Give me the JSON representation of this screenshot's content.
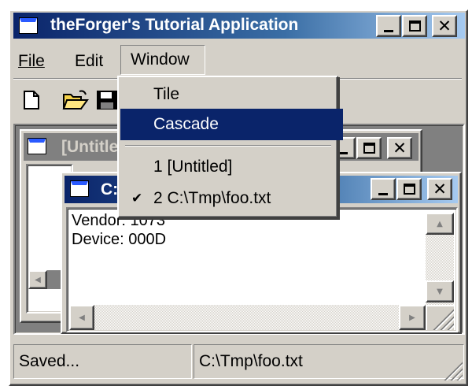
{
  "app": {
    "title": "theForger's Tutorial Application",
    "colors": {
      "face": "#d4d0c8",
      "active_title": "#0a246a",
      "inactive_title": "#808080",
      "mdi_bg": "#808080"
    }
  },
  "menubar": {
    "items": [
      {
        "label": "File"
      },
      {
        "label": "Edit"
      },
      {
        "label": "Window"
      }
    ]
  },
  "toolbar": {
    "buttons": [
      {
        "icon": "new-file-icon"
      },
      {
        "icon": "open-folder-icon"
      },
      {
        "icon": "save-disk-icon"
      }
    ]
  },
  "window_menu": {
    "items": [
      {
        "label": "Tile"
      },
      {
        "label": "Cascade",
        "highlighted": true
      },
      {
        "label": "1 [Untitled]"
      },
      {
        "label": "2 C:\\Tmp\\foo.txt",
        "checked": true
      }
    ]
  },
  "mdi_children": {
    "back": {
      "title": "[Untitled]"
    },
    "front": {
      "title": "C:",
      "text": "Vendor: 1073\nDevice: 000D"
    }
  },
  "statusbar": {
    "left": "Saved...",
    "right": "C:\\Tmp\\foo.txt"
  }
}
